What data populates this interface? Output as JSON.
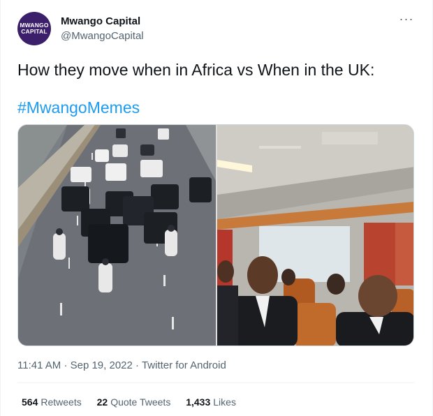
{
  "author": {
    "name": "Mwango Capital",
    "handle": "@MwangoCapital",
    "avatar_line1": "MWANGO",
    "avatar_line2": "CAPITAL"
  },
  "tweet": {
    "text": "How they move when in Africa vs When in the UK:",
    "hashtag": "#MwangoMemes",
    "more_icon": "more-dots-icon"
  },
  "meta": {
    "time": "11:41 AM",
    "date": "Sep 19, 2022",
    "source": "Twitter for Android",
    "separator": "·"
  },
  "stats": {
    "retweets_count": "564",
    "retweets_label": "Retweets",
    "quotes_count": "22",
    "quotes_label": "Quote Tweets",
    "likes_count": "1,433",
    "likes_label": "Likes"
  },
  "colors": {
    "link": "#1d9bf0",
    "secondary_text": "#536471",
    "avatar_bg": "#3b1f6b"
  }
}
